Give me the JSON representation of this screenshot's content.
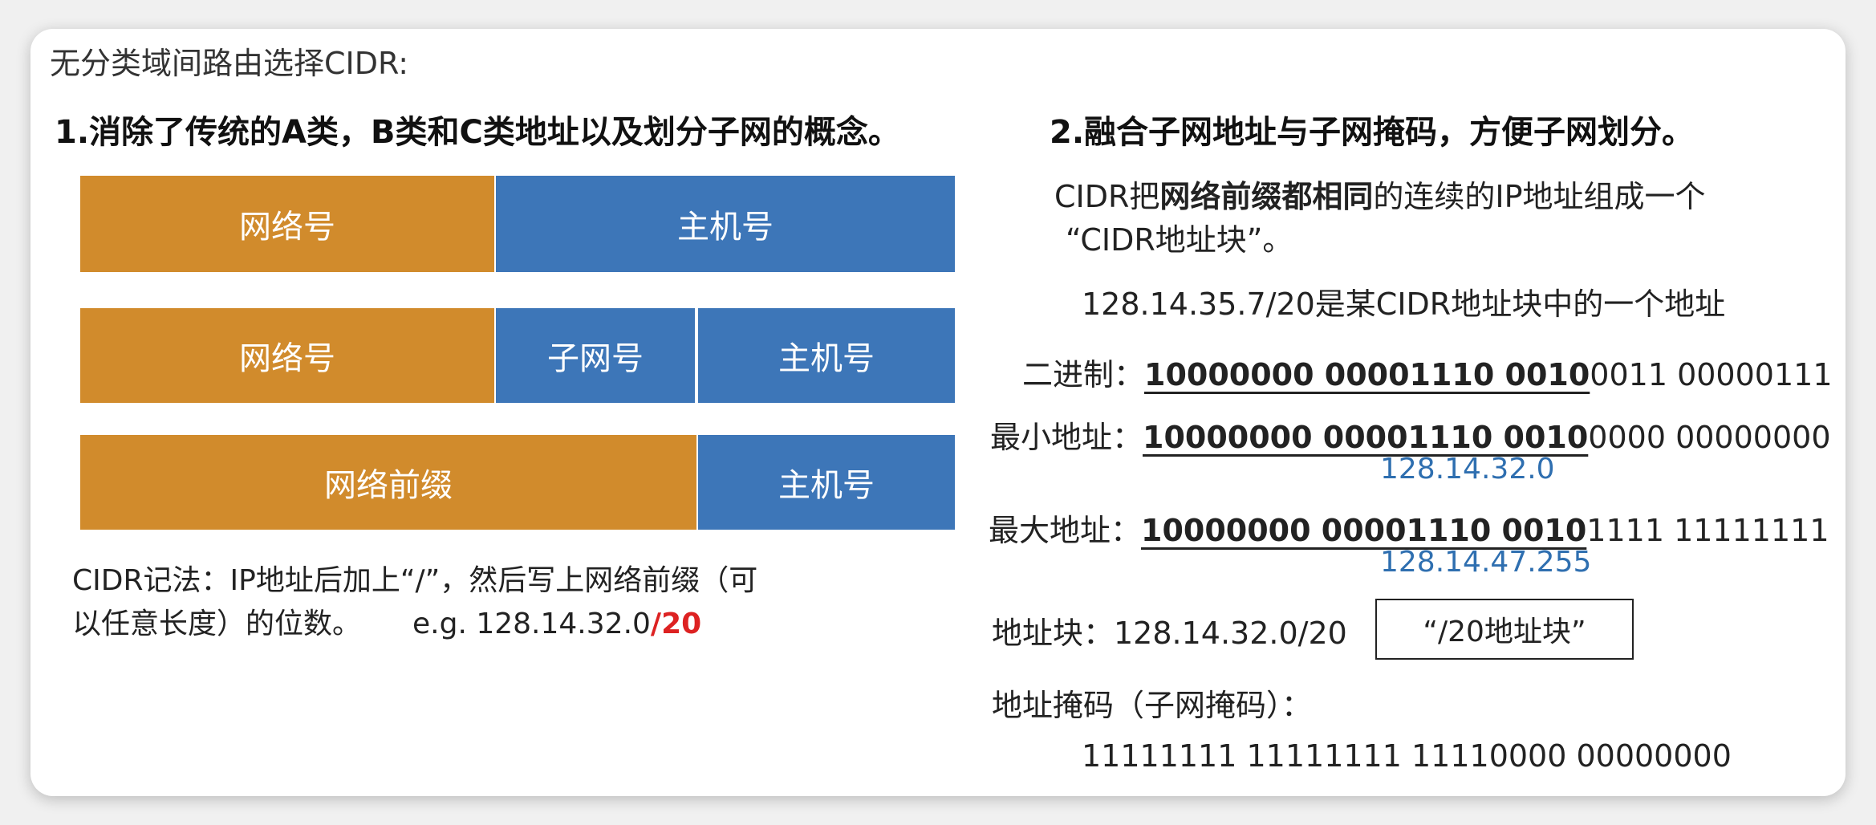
{
  "title": "无分类域间路由选择CIDR:",
  "left": {
    "heading": "1.消除了传统的A类，B类和C类地址以及划分子网的概念。",
    "row1": {
      "network": "网络号",
      "host": "主机号"
    },
    "row2": {
      "network": "网络号",
      "subnet": "子网号",
      "host": "主机号"
    },
    "row3": {
      "prefix": "网络前缀",
      "host": "主机号"
    },
    "notation_line1": "CIDR记法：IP地址后加上“/”，然后写上网络前缀（可",
    "notation_line2": "以任意长度）的位数。",
    "example_prefix": "e.g. 128.14.32.0",
    "example_suffix": "/20"
  },
  "right": {
    "heading": "2.融合子网地址与子网掩码，方便子网划分。",
    "desc_a": "CIDR把",
    "desc_b": "网络前缀都相同",
    "desc_c": "的连续的IP地址组成一个",
    "desc_line2": "“CIDR地址块”。",
    "example": "128.14.35.7/20是某CIDR地址块中的一个地址",
    "binary_label": "二进制：",
    "binary_prefix": "10000000  00001110   0010",
    "binary_rest": "0011  00000111",
    "min_label": "最小地址：",
    "min_prefix": "10000000  00001110   0010",
    "min_rest": "0000  00000000",
    "min_dotted": "128.14.32.0",
    "max_label": "最大地址：",
    "max_prefix": "10000000  00001110   0010",
    "max_rest": "1111  11111111",
    "max_dotted": "128.14.47.255",
    "block_label": "地址块：128.14.32.0/20",
    "block_box": "“/20地址块”",
    "mask_label": "地址掩码（子网掩码）：",
    "mask_value": "11111111   11111111   11110000   00000000"
  },
  "colors": {
    "network": "#d18b2c",
    "host": "#3d76b8",
    "accent": "#dd2222",
    "dotted": "#2f6fb0"
  }
}
